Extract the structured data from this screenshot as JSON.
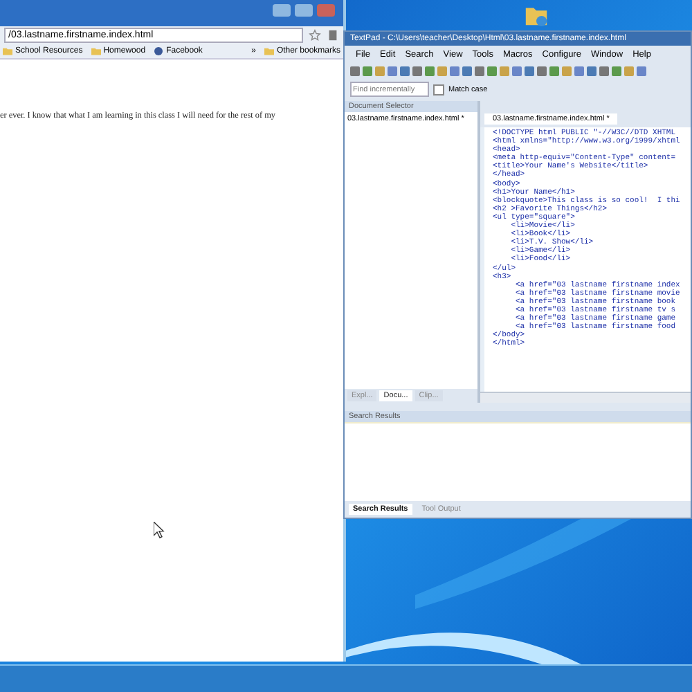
{
  "browser": {
    "address": "/03.lastname.firstname.index.html",
    "bookmarks": [
      {
        "label": "School Resources",
        "kind": "folder"
      },
      {
        "label": "Homewood",
        "kind": "folder"
      },
      {
        "label": "Facebook",
        "kind": "site"
      }
    ],
    "bookmarks_more": "»",
    "other_bookmarks": "Other bookmarks",
    "content": "er ever. I know that what I am learning in this class I will need for the rest of my"
  },
  "textpad": {
    "title": "TextPad - C:\\Users\\teacher\\Desktop\\Html\\03.lastname.firstname.index.html",
    "menu": [
      "File",
      "Edit",
      "Search",
      "View",
      "Tools",
      "Macros",
      "Configure",
      "Window",
      "Help"
    ],
    "find": {
      "placeholder": "Find incrementally",
      "match_case": "Match case",
      "checked": false
    },
    "document_selector": {
      "title": "Document Selector",
      "items": [
        "03.lastname.firstname.index.html *"
      ]
    },
    "side_tabs": [
      {
        "label": "Expl...",
        "selected": false
      },
      {
        "label": "Docu...",
        "selected": true
      },
      {
        "label": "Clip...",
        "selected": false
      }
    ],
    "editor_tab": "03.lastname.firstname.index.html *",
    "code": [
      "<!DOCTYPE html PUBLIC \"-//W3C//DTD XHTML",
      "<html xmlns=\"http://www.w3.org/1999/xhtml",
      "<head>",
      "<meta http-equiv=\"Content-Type\" content=",
      "<title>Your Name's Website</title>",
      "</head>",
      "<body>",
      "<h1>Your Name</h1>",
      "<blockquote>This class is so cool!  I thi",
      "<h2 >Favorite Things</h2>",
      "<ul type=\"square\">",
      "    <li>Movie</li>",
      "    <li>Book</li>",
      "    <li>T.V. Show</li>",
      "    <li>Game</li>",
      "    <li>Food</li>",
      "</ul>",
      "<h3>",
      "     <a href=\"03 lastname firstname index",
      "     <a href=\"03 lastname firstname movie",
      "     <a href=\"03 lastname firstname book",
      "     <a href=\"03 lastname firstname tv s",
      "     <a href=\"03 lastname firstname game",
      "     <a href=\"03 lastname firstname food",
      "</body>",
      "</html>"
    ],
    "search_results": {
      "title": "Search Results"
    },
    "bottom_tabs": [
      {
        "label": "Search Results",
        "selected": true
      },
      {
        "label": "Tool Output",
        "selected": false
      }
    ]
  }
}
